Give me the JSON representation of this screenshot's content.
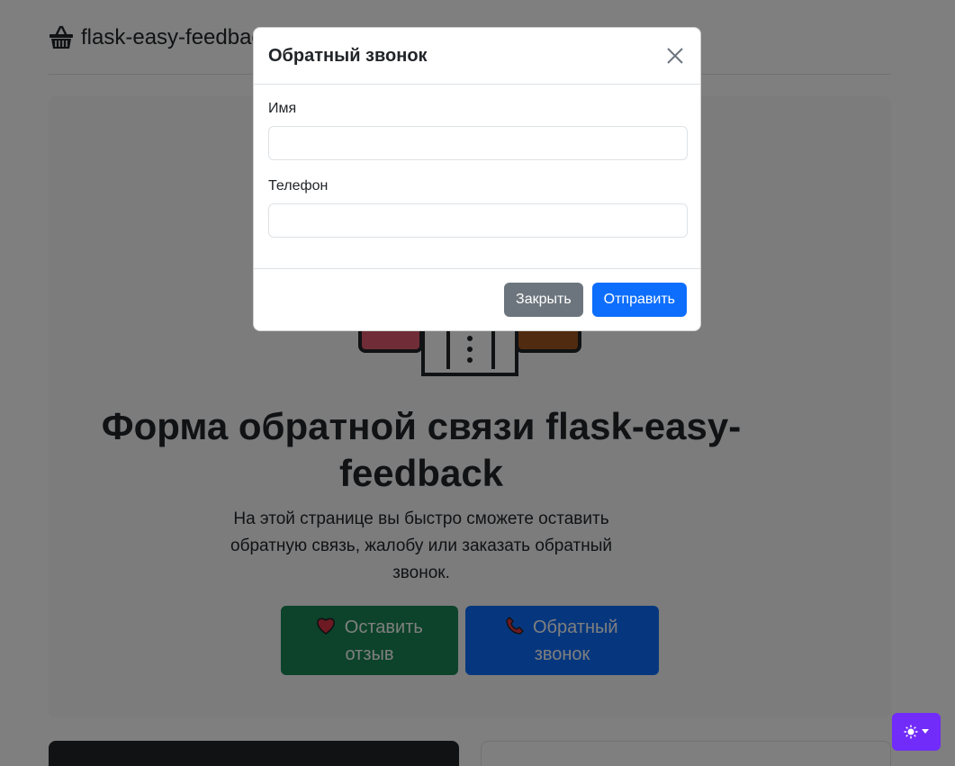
{
  "header": {
    "brand_icon": "basket-icon",
    "brand_text": "flask-easy-feedback"
  },
  "hero": {
    "illustration": "market-stall-illustration",
    "title": "Форма обратной связи flask-easy-feedback",
    "lead": "На этой странице вы быстро сможете оставить обратную связь, жалобу или заказать обратный звонок.",
    "feedback_button": {
      "icon": "heart-icon",
      "label": "Оставить отзыв",
      "color": "#198754"
    },
    "call_button": {
      "icon": "phone-icon",
      "label": "Обратный звонок",
      "color": "#0d6efd"
    }
  },
  "theme_toggle": {
    "icon": "sun-icon",
    "color": "#712cf9"
  },
  "modal": {
    "title": "Обратный звонок",
    "name_label": "Имя",
    "name_value": "",
    "phone_label": "Телефон",
    "phone_value": "",
    "close_label": "Закрыть",
    "submit_label": "Отправить"
  }
}
